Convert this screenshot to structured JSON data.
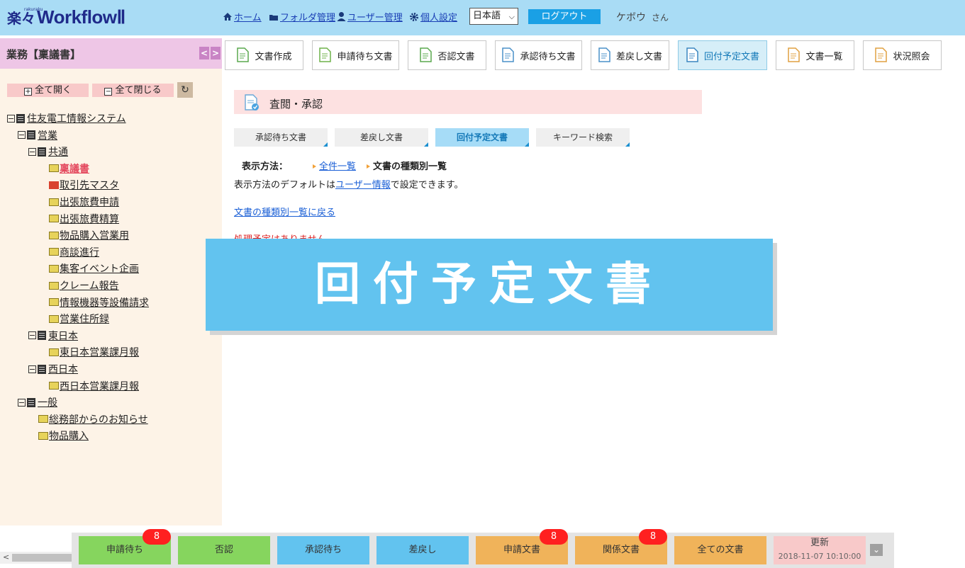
{
  "header": {
    "logo_kanji": "楽々",
    "logo_sub": "rakuraku",
    "logo_text": "WorkflowⅡ",
    "nav": {
      "home": "ホーム",
      "folder": "フォルダ管理",
      "user": "ユーザー管理",
      "personal": "個人設定"
    },
    "language": "日本語",
    "logout": "ログアウト",
    "user_name": "ケボウ",
    "user_suffix": "さん"
  },
  "sidebar": {
    "title": "業務【稟議書】",
    "expand_all": "全て開く",
    "collapse_all": "全て閉じる",
    "tree": [
      {
        "label": "住友電工情報システム",
        "type": "cabinet",
        "level": 0
      },
      {
        "label": "営業",
        "type": "cabinet",
        "level": 1
      },
      {
        "label": "共通",
        "type": "cabinet",
        "level": 2
      },
      {
        "label": "稟議書",
        "type": "folder",
        "level": 3,
        "selected": true
      },
      {
        "label": "取引先マスタ",
        "type": "mail",
        "level": 3
      },
      {
        "label": "出張旅費申請",
        "type": "folder",
        "level": 3
      },
      {
        "label": "出張旅費精算",
        "type": "folder",
        "level": 3
      },
      {
        "label": "物品購入営業用",
        "type": "folder",
        "level": 3
      },
      {
        "label": "商談進行",
        "type": "folder",
        "level": 3
      },
      {
        "label": "集客イベント企画",
        "type": "folder",
        "level": 3
      },
      {
        "label": "クレーム報告",
        "type": "folder",
        "level": 3
      },
      {
        "label": "情報機器等設備請求",
        "type": "folder",
        "level": 3
      },
      {
        "label": "営業住所録",
        "type": "folder",
        "level": 3
      },
      {
        "label": "東日本",
        "type": "cabinet",
        "level": 2
      },
      {
        "label": "東日本営業課月報",
        "type": "folder",
        "level": 3
      },
      {
        "label": "西日本",
        "type": "cabinet",
        "level": 2
      },
      {
        "label": "西日本営業課月報",
        "type": "folder",
        "level": 3
      },
      {
        "label": "一般",
        "type": "cabinet",
        "level": 1
      },
      {
        "label": "総務部からのお知らせ",
        "type": "folder",
        "level": 2
      },
      {
        "label": "物品購入",
        "type": "folder",
        "level": 2
      }
    ]
  },
  "toolbar": [
    {
      "label": "文書作成",
      "icon": "doc-create-icon"
    },
    {
      "label": "申請待ち文書",
      "icon": "doc-pending-icon"
    },
    {
      "label": "否認文書",
      "icon": "doc-rejected-icon"
    },
    {
      "label": "承認待ち文書",
      "icon": "doc-approval-icon"
    },
    {
      "label": "差戻し文書",
      "icon": "doc-return-icon"
    },
    {
      "label": "回付予定文書",
      "icon": "doc-route-icon",
      "active": true
    },
    {
      "label": "文書一覧",
      "icon": "doc-list-icon"
    },
    {
      "label": "状況照会",
      "icon": "status-inquiry-icon"
    }
  ],
  "main": {
    "section_title": "査閲・承認",
    "subtabs": [
      {
        "label": "承認待ち文書"
      },
      {
        "label": "差戻し文書"
      },
      {
        "label": "回付予定文書",
        "active": true
      },
      {
        "label": "キーワード検索"
      }
    ],
    "display_label": "表示方法：",
    "display_all": "全件一覧",
    "display_by_type": "文書の種類別一覧",
    "default_note_pre": "表示方法のデフォルトは",
    "default_note_link": "ユーザー情報",
    "default_note_post": "で設定できます。",
    "back_link": "文書の種類別一覧に戻る",
    "no_items": "処理予定はありません。",
    "overlay_text": "回付予定文書"
  },
  "bottom": {
    "items": [
      {
        "label": "申請待ち",
        "badge": "8"
      },
      {
        "label": "否認"
      },
      {
        "label": "承認待ち"
      },
      {
        "label": "差戻し"
      },
      {
        "label": "申請文書",
        "badge": "8"
      },
      {
        "label": "関係文書",
        "badge": "8"
      },
      {
        "label": "全ての文書"
      }
    ],
    "update_label": "更新",
    "update_time": "2018-11-07 10:10:00"
  }
}
